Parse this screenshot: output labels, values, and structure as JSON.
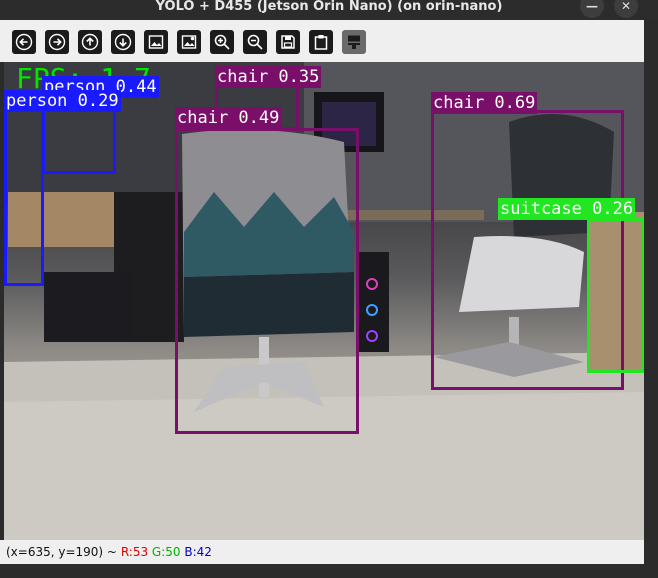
{
  "window": {
    "title": "YOLO + D455 (Jetson Orin Nano) (on orin-nano)"
  },
  "toolbar": {
    "tools": [
      {
        "icon": "arrow-left-icon"
      },
      {
        "icon": "arrow-right-icon"
      },
      {
        "icon": "arrow-up-icon"
      },
      {
        "icon": "arrow-down-icon"
      },
      {
        "icon": "image-icon"
      },
      {
        "icon": "image-settings-icon"
      },
      {
        "icon": "zoom-in-icon"
      },
      {
        "icon": "zoom-out-icon"
      },
      {
        "icon": "save-icon"
      },
      {
        "icon": "clipboard-icon"
      },
      {
        "icon": "properties-icon"
      }
    ]
  },
  "overlay": {
    "fps": "FPS: 1.7",
    "detections": [
      {
        "label": "person 0.44",
        "color": "#1a1aff"
      },
      {
        "label": "person 0.29",
        "color": "#1a1aff"
      },
      {
        "label": "chair 0.35",
        "color": "#7a0f6a"
      },
      {
        "label": "chair 0.49",
        "color": "#7a0f6a"
      },
      {
        "label": "chair 0.69",
        "color": "#7a0f6a"
      },
      {
        "label": "suitcase 0.26",
        "color": "#22e622"
      }
    ]
  },
  "status": {
    "coords": "(x=635, y=190) ~",
    "r": "R:53",
    "g": "G:50",
    "b": "B:42",
    "r_color": "#e00000",
    "g_color": "#00b000",
    "b_color": "#0000d0"
  }
}
